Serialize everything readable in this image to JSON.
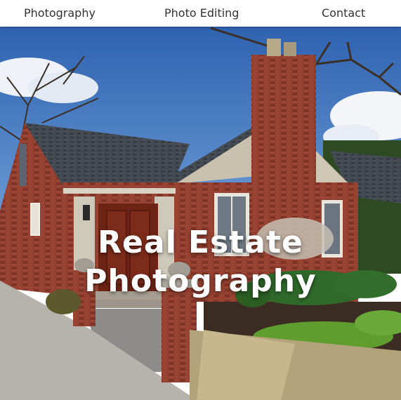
{
  "nav": {
    "items": [
      {
        "label": "Photography"
      },
      {
        "label": "Photo Editing"
      },
      {
        "label": "Contact"
      }
    ]
  },
  "hero": {
    "title_line_1": "Real Estate",
    "title_line_2": "Photography",
    "image_subject": "brick-house-photo"
  },
  "colors": {
    "nav_background": "#ffffff",
    "nav_text": "#333333",
    "hero_title": "#ffffff",
    "sky": "#3f78c4",
    "brick": "#8a3b2c",
    "roof": "#3f454c",
    "door": "#6e2415",
    "lawn": "#4f8a2b"
  }
}
